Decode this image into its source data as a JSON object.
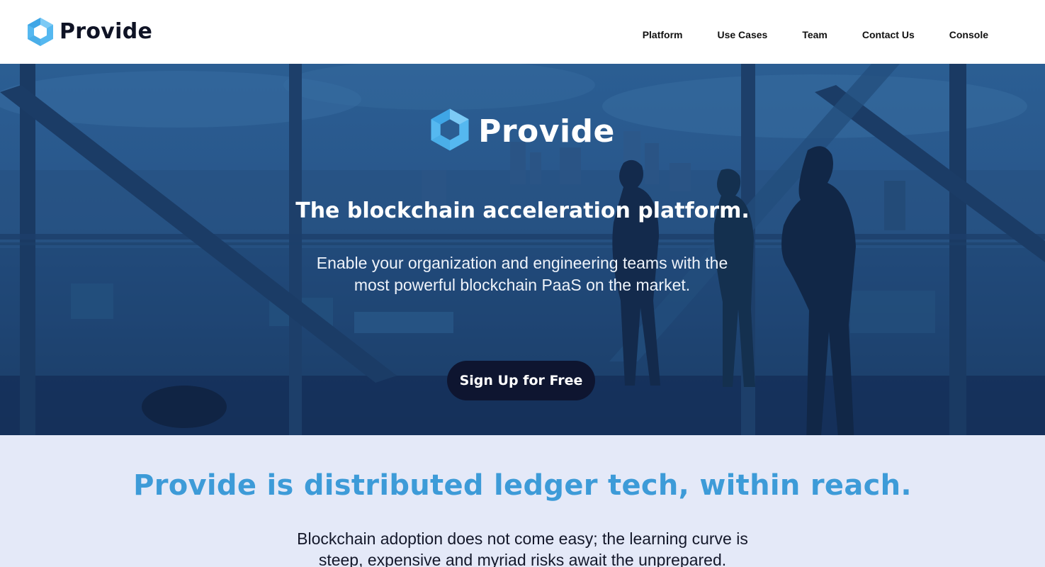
{
  "header": {
    "brand_name": "Provide",
    "nav": [
      {
        "label": "Platform"
      },
      {
        "label": "Use Cases"
      },
      {
        "label": "Team"
      },
      {
        "label": "Contact Us"
      },
      {
        "label": "Console"
      }
    ]
  },
  "hero": {
    "brand_name": "Provide",
    "title": "The blockchain acceleration platform.",
    "subtitle": "Enable your organization and engineering teams with the most powerful blockchain PaaS on the market.",
    "cta_label": "Sign Up for Free"
  },
  "intro": {
    "title": "Provide is distributed ledger tech, within reach.",
    "body": "Blockchain adoption does not come easy; the learning curve is steep, expensive and myriad risks await the unprepared."
  },
  "colors": {
    "brand_dark": "#0f1325",
    "logo_blue": "#55b8f0",
    "hero_overlay": "#2b5e93",
    "cta_bg": "#0e1530",
    "intro_bg": "#e4e9f8",
    "intro_title": "#3d9bd8"
  },
  "icons": {
    "logo": "hexagon-logo-icon"
  }
}
